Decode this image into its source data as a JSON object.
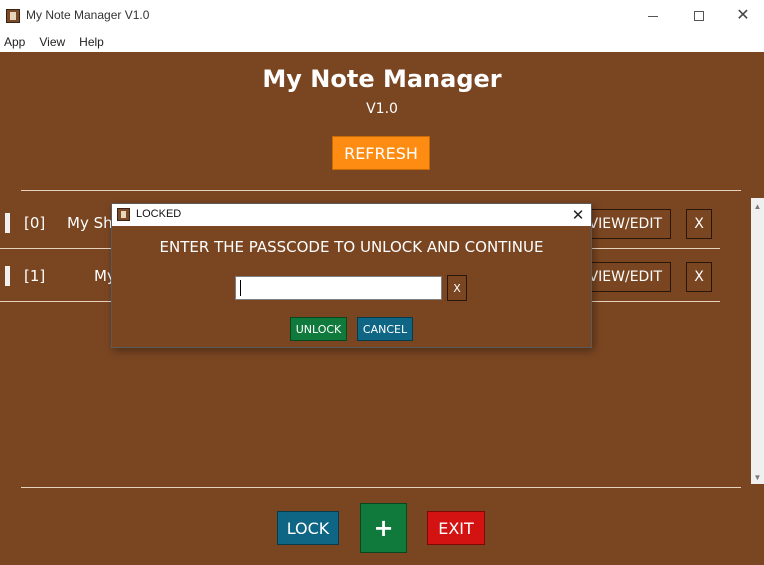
{
  "window": {
    "title": "My Note Manager V1.0",
    "icon": "notebook-icon",
    "controls": {
      "minimize": "minimize-icon",
      "maximize": "maximize-icon",
      "close": "close-icon"
    }
  },
  "menu": {
    "items": [
      "App",
      "View",
      "Help"
    ]
  },
  "header": {
    "title": "My Note Manager",
    "version": "V1.0",
    "refresh_label": "REFRESH"
  },
  "notes": [
    {
      "index": "[0]",
      "title": "My Sh",
      "view_edit_label": "VIEW/EDIT",
      "delete_label": "X"
    },
    {
      "index": "[1]",
      "title": "My",
      "view_edit_label": "VIEW/EDIT",
      "delete_label": "X"
    }
  ],
  "footer": {
    "lock_label": "LOCK",
    "add_label": "+",
    "exit_label": "EXIT"
  },
  "dialog": {
    "title": "LOCKED",
    "close_label": "✕",
    "prompt": "ENTER THE PASSCODE TO UNLOCK AND CONTINUE",
    "passcode_value": "",
    "clear_label": "X",
    "unlock_label": "UNLOCK",
    "cancel_label": "CANCEL"
  },
  "colors": {
    "background": "#7a4622",
    "refresh": "#ff8c12",
    "unlock_add": "#0f7a3c",
    "lock_cancel": "#0e6684",
    "exit": "#d31212"
  }
}
